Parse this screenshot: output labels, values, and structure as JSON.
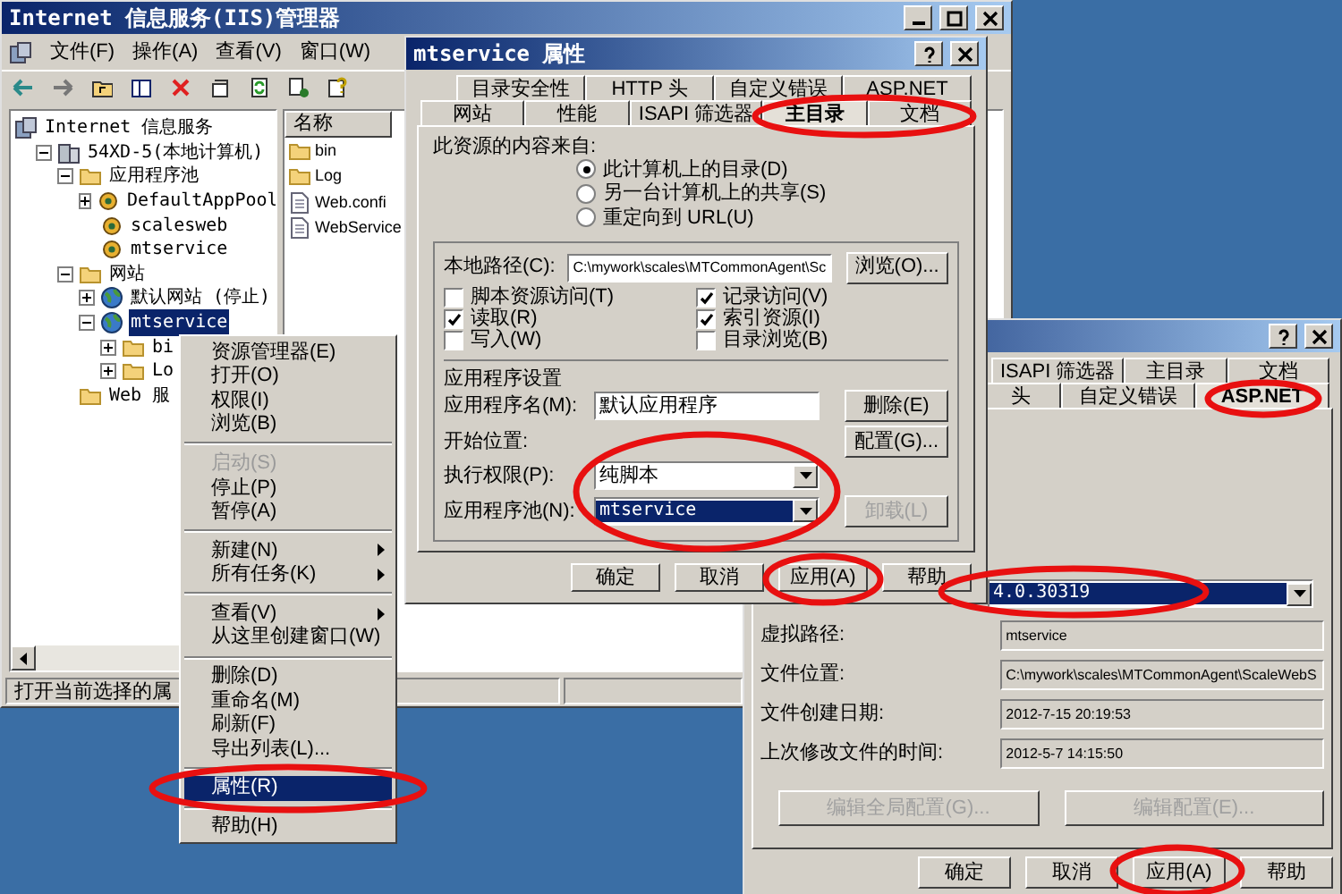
{
  "iis_window": {
    "title": "Internet 信息服务(IIS)管理器",
    "menu": [
      "文件(F)",
      "操作(A)",
      "查看(V)",
      "窗口(W)"
    ],
    "tree": [
      {
        "label": "Internet 信息服务",
        "kind": "services",
        "selected": false,
        "children": [
          {
            "label": "54XD-5(本地计算机)",
            "kind": "computer",
            "expanded": true,
            "selected": false,
            "children": [
              {
                "label": "应用程序池",
                "kind": "folder",
                "expanded": true,
                "selected": false,
                "children": [
                  {
                    "label": "DefaultAppPool",
                    "kind": "pool",
                    "expanded": false,
                    "selected": false
                  },
                  {
                    "label": "scalesweb",
                    "kind": "pool",
                    "selected": false
                  },
                  {
                    "label": "mtservice",
                    "kind": "pool",
                    "selected": false
                  }
                ]
              },
              {
                "label": "网站",
                "kind": "folder",
                "expanded": true,
                "selected": false,
                "children": [
                  {
                    "label": "默认网站 (停止)",
                    "kind": "globe",
                    "expanded": false,
                    "selected": false
                  },
                  {
                    "label": "mtservice",
                    "kind": "globe",
                    "expanded": true,
                    "selected": true,
                    "children": [
                      {
                        "label": "bi",
                        "kind": "folder",
                        "expanded": false,
                        "selected": false
                      },
                      {
                        "label": "Lo",
                        "kind": "folder",
                        "expanded": false,
                        "selected": false
                      }
                    ]
                  }
                ]
              },
              {
                "label": "Web 服",
                "kind": "folder",
                "selected": false
              }
            ]
          }
        ]
      }
    ],
    "list": {
      "column": "名称",
      "items": [
        {
          "name": "bin",
          "kind": "folder"
        },
        {
          "name": "Log",
          "kind": "folder"
        },
        {
          "name": "Web.confi",
          "kind": "file"
        },
        {
          "name": "WebService",
          "kind": "file"
        }
      ]
    },
    "status_bar": "打开当前选择的属"
  },
  "context_menu": {
    "groups": [
      [
        {
          "label": "资源管理器(E)",
          "disabled": false,
          "submenu": false,
          "selected": false
        },
        {
          "label": "打开(O)",
          "disabled": false,
          "submenu": false,
          "selected": false
        },
        {
          "label": "权限(I)",
          "disabled": false,
          "submenu": false,
          "selected": false
        },
        {
          "label": "浏览(B)",
          "disabled": false,
          "submenu": false,
          "selected": false
        }
      ],
      [
        {
          "label": "启动(S)",
          "disabled": true,
          "submenu": false,
          "selected": false
        },
        {
          "label": "停止(P)",
          "disabled": false,
          "submenu": false,
          "selected": false
        },
        {
          "label": "暂停(A)",
          "disabled": false,
          "submenu": false,
          "selected": false
        }
      ],
      [
        {
          "label": "新建(N)",
          "disabled": false,
          "submenu": true,
          "selected": false
        },
        {
          "label": "所有任务(K)",
          "disabled": false,
          "submenu": true,
          "selected": false
        }
      ],
      [
        {
          "label": "查看(V)",
          "disabled": false,
          "submenu": true,
          "selected": false
        },
        {
          "label": "从这里创建窗口(W)",
          "disabled": false,
          "submenu": false,
          "selected": false
        }
      ],
      [
        {
          "label": "删除(D)",
          "disabled": false,
          "submenu": false,
          "selected": false
        },
        {
          "label": "重命名(M)",
          "disabled": false,
          "submenu": false,
          "selected": false
        },
        {
          "label": "刷新(F)",
          "disabled": false,
          "submenu": false,
          "selected": false
        },
        {
          "label": "导出列表(L)...",
          "disabled": false,
          "submenu": false,
          "selected": false
        }
      ],
      [
        {
          "label": "属性(R)",
          "disabled": false,
          "submenu": false,
          "selected": true
        }
      ],
      [
        {
          "label": "帮助(H)",
          "disabled": false,
          "submenu": false,
          "selected": false
        }
      ]
    ]
  },
  "properties_dialog": {
    "title": "mtservice 属性",
    "tabs_back": [
      {
        "label": "目录安全性",
        "selected": false
      },
      {
        "label": "HTTP 头",
        "selected": false
      },
      {
        "label": "自定义错误",
        "selected": false
      },
      {
        "label": "ASP.NET",
        "selected": false
      }
    ],
    "tabs_front": [
      {
        "label": "网站",
        "selected": false
      },
      {
        "label": "性能",
        "selected": false
      },
      {
        "label": "ISAPI 筛选器",
        "selected": false
      },
      {
        "label": "主目录",
        "selected": true
      },
      {
        "label": "文档",
        "selected": false
      }
    ],
    "source_label": "此资源的内容来自:",
    "sources": [
      {
        "label": "此计算机上的目录(D)",
        "selected": true
      },
      {
        "label": "另一台计算机上的共享(S)",
        "selected": false
      },
      {
        "label": "重定向到 URL(U)",
        "selected": false
      }
    ],
    "local_path_label": "本地路径(C):",
    "local_path": "C:\\mywork\\scales\\MTCommonAgent\\Sc",
    "browse_button": "浏览(O)...",
    "permissions": [
      {
        "label": "脚本资源访问(T)",
        "checked": false
      },
      {
        "label": "记录访问(V)",
        "checked": true
      },
      {
        "label": "读取(R)",
        "checked": true
      },
      {
        "label": "索引资源(I)",
        "checked": true
      },
      {
        "label": "写入(W)",
        "checked": false
      },
      {
        "label": "目录浏览(B)",
        "checked": false
      }
    ],
    "app_section": "应用程序设置",
    "app_name_label": "应用程序名(M):",
    "app_name": "默认应用程序",
    "remove_button": "删除(E)",
    "start_label": "开始位置:",
    "config_button": "配置(G)...",
    "exec_label": "执行权限(P):",
    "exec_value": "纯脚本",
    "pool_label": "应用程序池(N):",
    "pool_value": "mtservice",
    "unload_button": "卸载(L)",
    "buttons": [
      "确定",
      "取消",
      "应用(A)",
      "帮助"
    ]
  },
  "aspnet_dialog": {
    "tabs_back": [
      {
        "label": "ISAPI 筛选器",
        "selected": false
      },
      {
        "label": "主目录",
        "selected": false
      },
      {
        "label": "文档",
        "selected": false
      }
    ],
    "tabs_front": [
      {
        "label": "头",
        "selected": false
      },
      {
        "label": "自定义错误",
        "selected": false
      },
      {
        "label": "ASP.NET",
        "selected": true
      }
    ],
    "version": "4.0.30319",
    "fields": [
      {
        "label": "虚拟路径:",
        "value": "mtservice"
      },
      {
        "label": "文件位置:",
        "value": "C:\\mywork\\scales\\MTCommonAgent\\ScaleWebS"
      },
      {
        "label": "文件创建日期:",
        "value": "2012-7-15 20:19:53"
      },
      {
        "label": "上次修改文件的时间:",
        "value": "2012-5-7 14:15:50"
      }
    ],
    "config_buttons": [
      "编辑全局配置(G)...",
      "编辑配置(E)..."
    ],
    "buttons": [
      "确定",
      "取消",
      "应用(A)",
      "帮助"
    ]
  }
}
